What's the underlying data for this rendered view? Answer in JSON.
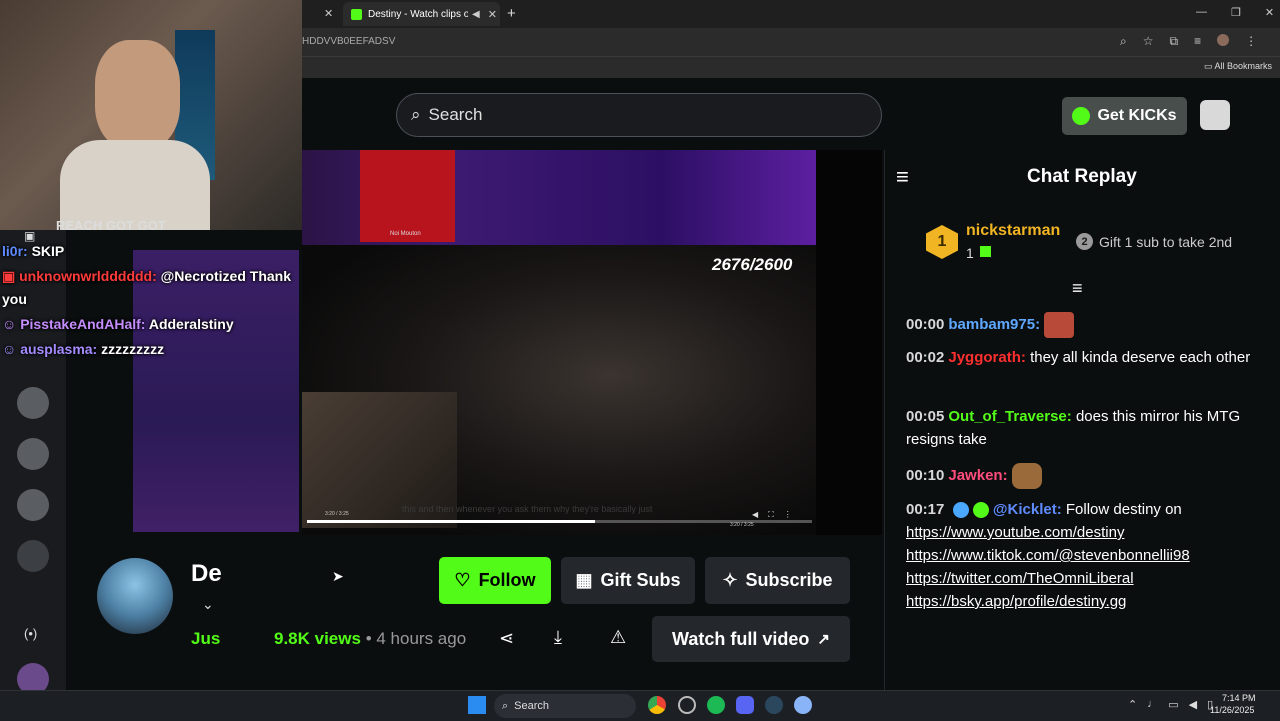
{
  "browser": {
    "tab_title": "Destiny - Watch clips on Ki",
    "address": "HDDVVB0EEFADSV",
    "bookmarks_label": "All Bookmarks"
  },
  "header": {
    "search_placeholder": "Search",
    "get_kicks_label": "Get KICKs"
  },
  "stream_overlay_chat": [
    {
      "user": "li0r:",
      "text": "SKIP",
      "color": "#5f8bff"
    },
    {
      "user": "unknownwrldddddd:",
      "text": "@Necrotized Thank",
      "color": "#ff3b3b"
    },
    {
      "user": "",
      "text": "you",
      "color": "#ffffff"
    },
    {
      "user": "PisstakeAndAHalf:",
      "text": "Adderalstiny",
      "color": "#c58dff"
    },
    {
      "user": "ausplasma:",
      "text": "zzzzzzzzz",
      "color": "#a58cff"
    }
  ],
  "stream_overlay_top_partial": "REACH GOT GOT",
  "video": {
    "overlay_counter": "2676/2600",
    "time_left": "3:20 / 3:25",
    "time_right": "3:20 / 3:25",
    "caption": "this and then whenever you ask them why they're basically just",
    "top_overlay_label": "Noi Mouton"
  },
  "channel": {
    "name_partial": "De",
    "subtitle_partial": "Jus",
    "follow_label": "Follow",
    "gift_subs_label": "Gift Subs",
    "subscribe_label": "Subscribe",
    "views": "9.8K views",
    "separator": "•",
    "age": "4 hours ago",
    "watch_full_label": "Watch full video"
  },
  "chat_replay": {
    "title": "Chat Replay",
    "top_gifter_rank": "1",
    "top_gifter_name": "nickstarman",
    "top_gifter_count": "1",
    "second_rank": "2",
    "second_text": "Gift 1 sub to take 2nd",
    "messages": [
      {
        "time": "00:00",
        "user": "bambam975:",
        "text": "",
        "color": "#5fa8ff"
      },
      {
        "time": "00:02",
        "user": "Jyggorath:",
        "text": "they all kinda deserve each other",
        "color": "#ff2f2f"
      },
      {
        "time": "00:05",
        "user": "Out_of_Traverse:",
        "text": "does this mirror his MTG resigns take",
        "color": "#53fc18"
      },
      {
        "time": "00:10",
        "user": "Jawken:",
        "text": "",
        "color": "#ff4d7d"
      },
      {
        "time": "00:17",
        "user": "@Kicklet:",
        "text": "Follow destiny on",
        "color": "#5f8bff"
      }
    ],
    "links": [
      "https://www.youtube.com/destiny",
      "https://www.tiktok.com/@stevenbonnellii98",
      "https://twitter.com/TheOmniLiberal",
      "https://bsky.app/profile/destiny.gg"
    ]
  },
  "taskbar": {
    "search_label": "Search",
    "time": "7:14 PM",
    "date": "11/26/2025"
  },
  "colors": {
    "kick_green": "#53fc18",
    "background": "#0b0e0f",
    "button_grey": "#24272c"
  }
}
